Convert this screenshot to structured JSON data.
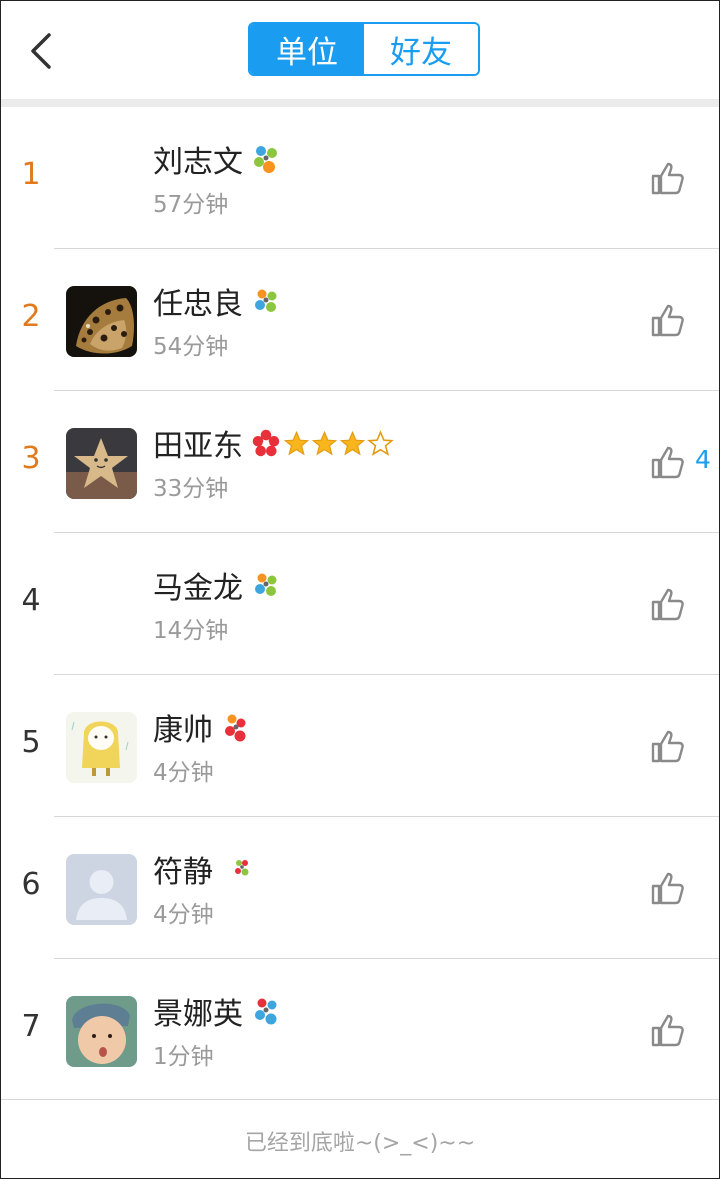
{
  "header": {
    "tabs": [
      {
        "label": "单位",
        "active": true
      },
      {
        "label": "好友",
        "active": false
      }
    ],
    "accent_color": "#1a9cf0"
  },
  "rows": [
    {
      "rank": "1",
      "name": "刘志文",
      "duration": "57分钟",
      "avatar": "none",
      "medal": "blue-green-orange-flower",
      "stars": 0,
      "likes": ""
    },
    {
      "rank": "2",
      "name": "任忠良",
      "duration": "54分钟",
      "avatar": "leopard",
      "medal": "blue-green-orange-flower",
      "stars": 0,
      "likes": ""
    },
    {
      "rank": "3",
      "name": "田亚东",
      "duration": "33分钟",
      "avatar": "star-toy",
      "medal": "red-flower",
      "stars": 3,
      "stars_total": 4,
      "likes": "4"
    },
    {
      "rank": "4",
      "name": "马金龙",
      "duration": "14分钟",
      "avatar": "none",
      "medal": "blue-green-orange-flower",
      "stars": 0,
      "likes": ""
    },
    {
      "rank": "5",
      "name": "康帅",
      "duration": "4分钟",
      "avatar": "cartoon-raincoat",
      "medal": "red-orange-flower",
      "stars": 0,
      "likes": ""
    },
    {
      "rank": "6",
      "name": "符静",
      "duration": "4分钟",
      "avatar": "default-person",
      "medal": "small-green-red-flower",
      "stars": 0,
      "likes": ""
    },
    {
      "rank": "7",
      "name": "景娜英",
      "duration": "1分钟",
      "avatar": "child-photo",
      "medal": "blue-red-flower",
      "stars": 0,
      "likes": ""
    }
  ],
  "footer": {
    "text": "已经到底啦~(>_<)~~"
  },
  "colors": {
    "top_rank": "#e07a1f",
    "rank": "#333333",
    "like_count": "#1a9cf0"
  }
}
